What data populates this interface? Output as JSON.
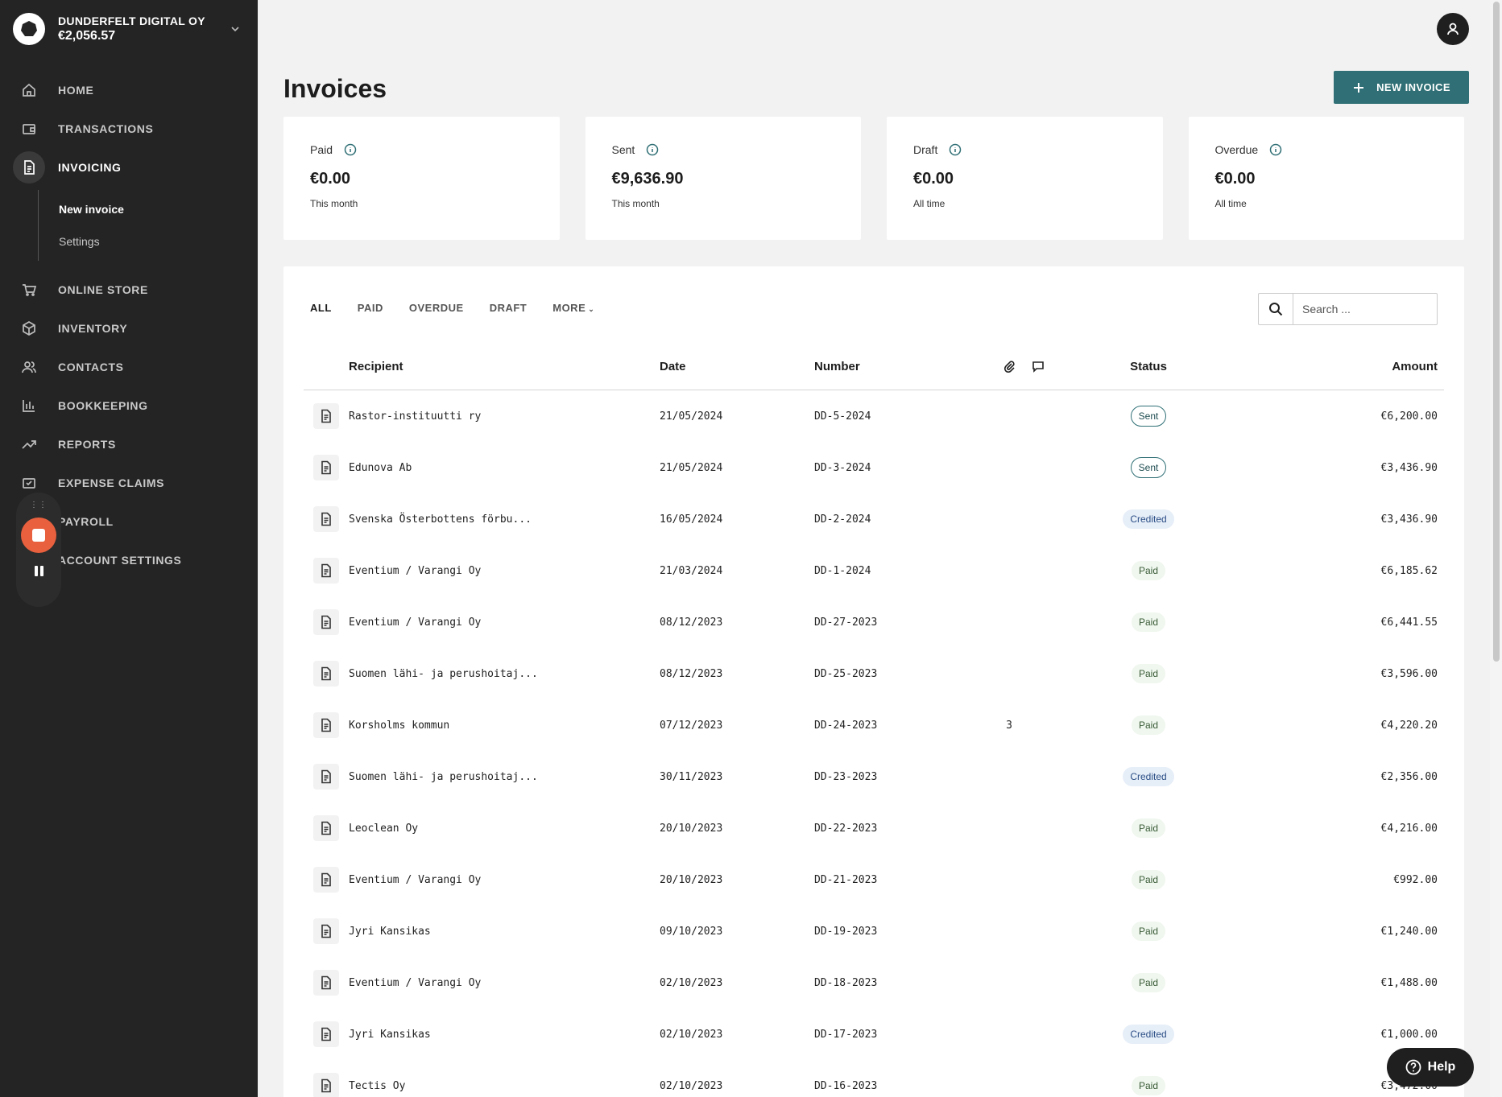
{
  "brand": {
    "name": "DUNDERFELT DIGITAL OY",
    "balance": "€2,056.57"
  },
  "nav": {
    "items": [
      {
        "label": "HOME",
        "icon": "home-icon"
      },
      {
        "label": "TRANSACTIONS",
        "icon": "wallet-icon"
      },
      {
        "label": "INVOICING",
        "icon": "document-icon"
      },
      {
        "label": "ONLINE STORE",
        "icon": "cart-icon"
      },
      {
        "label": "INVENTORY",
        "icon": "box-icon"
      },
      {
        "label": "CONTACTS",
        "icon": "people-icon"
      },
      {
        "label": "BOOKKEEPING",
        "icon": "bar-chart-icon"
      },
      {
        "label": "REPORTS",
        "icon": "trend-icon"
      },
      {
        "label": "EXPENSE CLAIMS",
        "icon": "expense-icon"
      },
      {
        "label": "PAYROLL",
        "icon": "payroll-icon"
      },
      {
        "label": "ACCOUNT SETTINGS",
        "icon": "settings-icon"
      }
    ],
    "sub": [
      "New invoice",
      "Settings"
    ]
  },
  "page": {
    "title": "Invoices",
    "new_invoice_label": "NEW INVOICE"
  },
  "cards": [
    {
      "label": "Paid",
      "value": "€0.00",
      "sub": "This month"
    },
    {
      "label": "Sent",
      "value": "€9,636.90",
      "sub": "This month"
    },
    {
      "label": "Draft",
      "value": "€0.00",
      "sub": "All time"
    },
    {
      "label": "Overdue",
      "value": "€0.00",
      "sub": "All time"
    }
  ],
  "filters": [
    "ALL",
    "PAID",
    "OVERDUE",
    "DRAFT",
    "MORE"
  ],
  "search": {
    "placeholder": "Search ..."
  },
  "table": {
    "headers": {
      "recipient": "Recipient",
      "date": "Date",
      "number": "Number",
      "status": "Status",
      "amount": "Amount"
    },
    "rows": [
      {
        "recipient": "Rastor-instituutti ry",
        "date": "21/05/2024",
        "number": "DD-5-2024",
        "attachments": "",
        "status": "Sent",
        "amount": "€6,200.00"
      },
      {
        "recipient": "Edunova Ab",
        "date": "21/05/2024",
        "number": "DD-3-2024",
        "attachments": "",
        "status": "Sent",
        "amount": "€3,436.90"
      },
      {
        "recipient": "Svenska Österbottens förbu...",
        "date": "16/05/2024",
        "number": "DD-2-2024",
        "attachments": "",
        "status": "Credited",
        "amount": "€3,436.90"
      },
      {
        "recipient": "Eventium / Varangi Oy",
        "date": "21/03/2024",
        "number": "DD-1-2024",
        "attachments": "",
        "status": "Paid",
        "amount": "€6,185.62"
      },
      {
        "recipient": "Eventium / Varangi Oy",
        "date": "08/12/2023",
        "number": "DD-27-2023",
        "attachments": "",
        "status": "Paid",
        "amount": "€6,441.55"
      },
      {
        "recipient": "Suomen lähi- ja perushoitaj...",
        "date": "08/12/2023",
        "number": "DD-25-2023",
        "attachments": "",
        "status": "Paid",
        "amount": "€3,596.00"
      },
      {
        "recipient": "Korsholms kommun",
        "date": "07/12/2023",
        "number": "DD-24-2023",
        "attachments": "3",
        "status": "Paid",
        "amount": "€4,220.20"
      },
      {
        "recipient": "Suomen lähi- ja perushoitaj...",
        "date": "30/11/2023",
        "number": "DD-23-2023",
        "attachments": "",
        "status": "Credited",
        "amount": "€2,356.00"
      },
      {
        "recipient": "Leoclean Oy",
        "date": "20/10/2023",
        "number": "DD-22-2023",
        "attachments": "",
        "status": "Paid",
        "amount": "€4,216.00"
      },
      {
        "recipient": "Eventium / Varangi Oy",
        "date": "20/10/2023",
        "number": "DD-21-2023",
        "attachments": "",
        "status": "Paid",
        "amount": "€992.00"
      },
      {
        "recipient": "Jyri Kansikas",
        "date": "09/10/2023",
        "number": "DD-19-2023",
        "attachments": "",
        "status": "Paid",
        "amount": "€1,240.00"
      },
      {
        "recipient": "Eventium / Varangi Oy",
        "date": "02/10/2023",
        "number": "DD-18-2023",
        "attachments": "",
        "status": "Paid",
        "amount": "€1,488.00"
      },
      {
        "recipient": "Jyri Kansikas",
        "date": "02/10/2023",
        "number": "DD-17-2023",
        "attachments": "",
        "status": "Credited",
        "amount": "€1,000.00"
      },
      {
        "recipient": "Tectis Oy",
        "date": "02/10/2023",
        "number": "DD-16-2023",
        "attachments": "",
        "status": "Paid",
        "amount": "€3,472.00"
      }
    ]
  },
  "help": {
    "label": "Help"
  },
  "colors": {
    "sidebar": "#242424",
    "accent": "#2f6f75",
    "recorder": "#e8603e"
  }
}
